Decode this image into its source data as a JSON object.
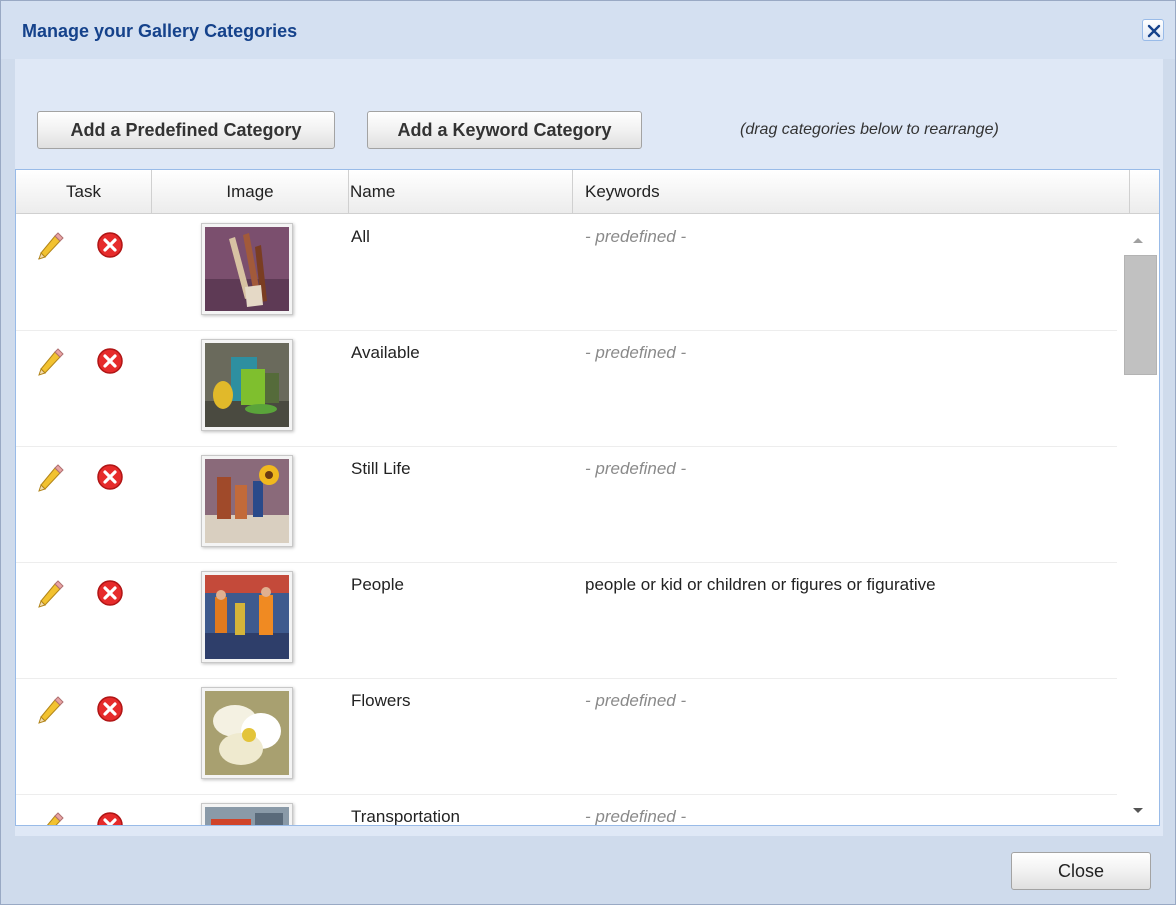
{
  "dialog": {
    "title": "Manage your Gallery Categories",
    "close_icon": "close-x-icon"
  },
  "toolbar": {
    "add_predefined_label": "Add a Predefined Category",
    "add_keyword_label": "Add a Keyword Category",
    "drag_hint": "(drag categories below to rearrange)"
  },
  "grid": {
    "columns": [
      "Task",
      "Image",
      "Name",
      "Keywords"
    ],
    "rows": [
      {
        "name": "All",
        "keywords": "- predefined -",
        "predefined": true,
        "thumbnail": "paintbrushes-thumbnail"
      },
      {
        "name": "Available",
        "keywords": "- predefined -",
        "predefined": true,
        "thumbnail": "still-life-pitcher-thumbnail"
      },
      {
        "name": "Still Life",
        "keywords": "- predefined -",
        "predefined": true,
        "thumbnail": "bottles-sunflower-thumbnail"
      },
      {
        "name": "People",
        "keywords": "people or kid or children or figures or figurative",
        "predefined": false,
        "thumbnail": "street-scene-people-thumbnail"
      },
      {
        "name": "Flowers",
        "keywords": "- predefined -",
        "predefined": true,
        "thumbnail": "white-flower-thumbnail"
      },
      {
        "name": "Transportation",
        "keywords": "- predefined -",
        "predefined": true,
        "thumbnail": "vehicles-thumbnail"
      }
    ],
    "row_icons": {
      "edit": "pencil-icon",
      "delete": "delete-x-icon"
    }
  },
  "footer": {
    "close_label": "Close"
  },
  "colors": {
    "title": "#15428b",
    "frame": "#cfdbec",
    "panel": "#dfe8f6",
    "delete_icon": "#e62b2b",
    "predefined_text": "#8a8a8a"
  }
}
